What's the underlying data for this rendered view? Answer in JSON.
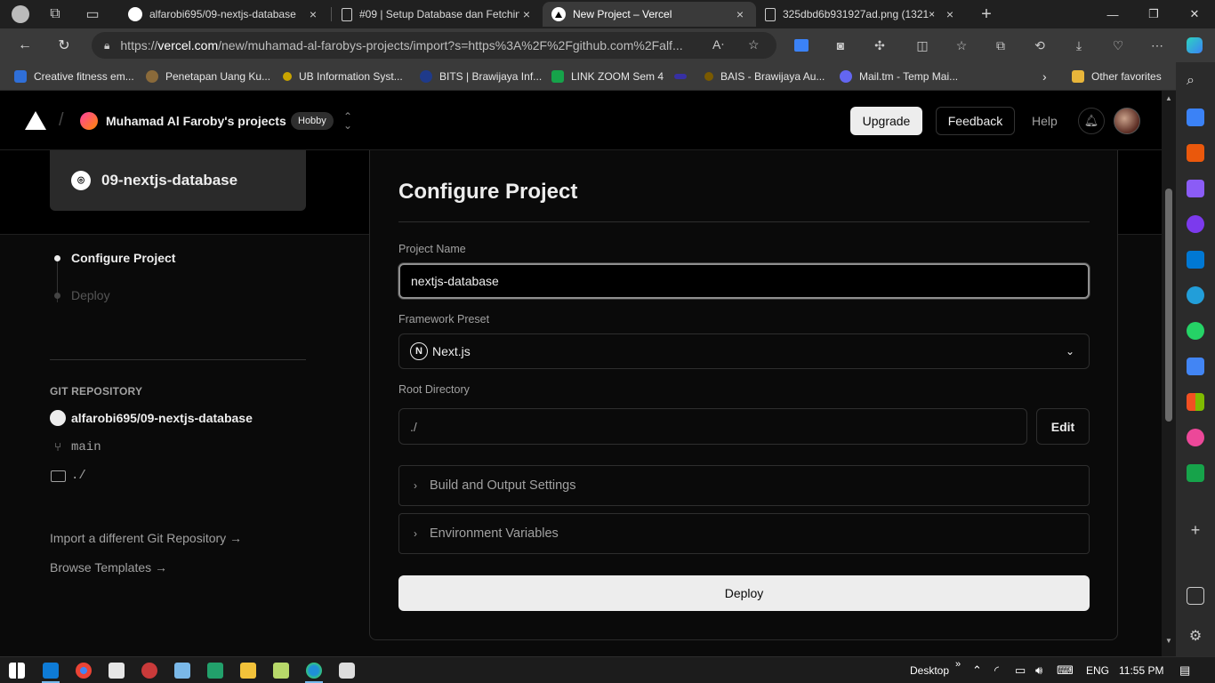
{
  "browser": {
    "tabs": [
      {
        "title": "alfarobi695/09-nextjs-database",
        "icon": "github-icon"
      },
      {
        "title": "#09 | Setup Database dan Fetchin",
        "icon": "page-icon"
      },
      {
        "title": "New Project – Vercel",
        "icon": "vercel-icon",
        "active": true
      },
      {
        "title": "325dbd6b931927ad.png (1321×",
        "icon": "page-icon"
      }
    ],
    "new_tab_label": "+",
    "url_prefix": "https://",
    "url_domain": "vercel.com",
    "url_path": "/new/muhamad-al-farobys-projects/import?s=https%3A%2F%2Fgithub.com%2Falf...",
    "bookmarks": [
      {
        "label": "Creative fitness em...",
        "color": "#2f6fd8"
      },
      {
        "label": "Penetapan Uang Ku...",
        "color": "#8a6a3a"
      },
      {
        "label": "UB Information Syst...",
        "color": "#c9a400"
      },
      {
        "label": "BITS | Brawijaya Inf...",
        "color": "#1f3a8a"
      },
      {
        "label": "LINK ZOOM Sem 4",
        "color": "#16a34a"
      },
      {
        "label": "BAIS - Brawijaya Au...",
        "color": "#7a5a00"
      },
      {
        "label": "Mail.tm - Temp Mai...",
        "color": "#6366f1"
      }
    ],
    "other_favorites": "Other favorites"
  },
  "header": {
    "team_name": "Muhamad Al Faroby's projects",
    "plan_badge": "Hobby",
    "upgrade_label": "Upgrade",
    "feedback_label": "Feedback",
    "help_label": "Help"
  },
  "sidebar": {
    "repo_card_name": "09-nextjs-database",
    "steps": [
      {
        "label": "Configure Project",
        "active": true
      },
      {
        "label": "Deploy",
        "active": false
      }
    ],
    "git_heading": "GIT REPOSITORY",
    "repo_full_name": "alfarobi695/09-nextjs-database",
    "branch": "main",
    "directory": "./",
    "import_link": "Import a different Git Repository →",
    "templates_link": "Browse Templates →"
  },
  "configure": {
    "title": "Configure Project",
    "project_name_label": "Project Name",
    "project_name_value": "nextjs-database",
    "framework_label": "Framework Preset",
    "framework_value": "Next.js",
    "root_dir_label": "Root Directory",
    "root_dir_value": "./",
    "edit_label": "Edit",
    "build_settings_label": "Build and Output Settings",
    "env_vars_label": "Environment Variables",
    "deploy_label": "Deploy"
  },
  "taskbar": {
    "desktop_label": "Desktop",
    "language": "ENG",
    "time": "11:55 PM"
  },
  "colors": {
    "page_bg": "#0a0a0a",
    "primary_button": "#ededed",
    "muted_text": "#a1a1a1",
    "border": "#2e2e2e"
  }
}
